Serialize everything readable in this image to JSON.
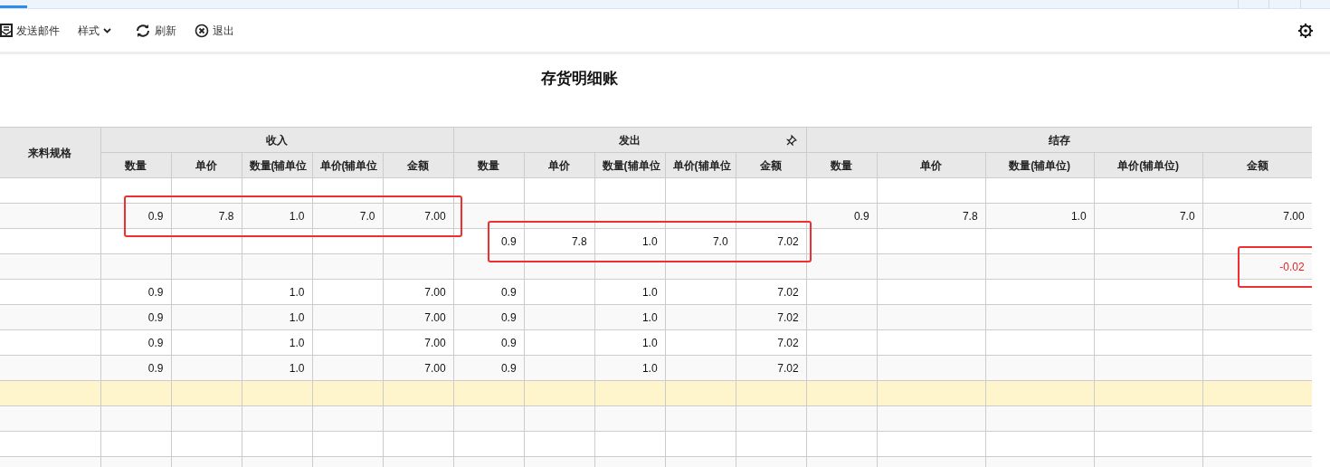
{
  "toolbar": {
    "items": [
      {
        "kind": "mail",
        "label": "发送邮件"
      },
      {
        "kind": "dropdown",
        "label": "样式"
      },
      {
        "kind": "refresh",
        "label": "刷新"
      },
      {
        "kind": "exit",
        "label": "退出"
      }
    ]
  },
  "title": "存货明细账",
  "table": {
    "first_column": "来料规格",
    "groups": [
      {
        "label": "收入",
        "pinned": false,
        "columns": [
          "数量",
          "单价",
          "数量(辅单位",
          "单价(辅单位",
          "金额"
        ]
      },
      {
        "label": "发出",
        "pinned": true,
        "columns": [
          "数量",
          "单价",
          "数量(辅单位",
          "单价(辅单位",
          "金额"
        ]
      },
      {
        "label": "结存",
        "pinned": false,
        "columns": [
          "数量",
          "单价",
          "数量(辅单位)",
          "单价(辅单位)",
          "金额"
        ]
      }
    ],
    "rows": [
      {
        "selected": false,
        "box_income": false,
        "box_issue": false,
        "box_balance_amount": false,
        "cells": [
          "",
          "",
          "",
          "",
          "",
          "",
          "",
          "",
          "",
          "",
          "",
          "",
          "",
          "",
          "",
          ""
        ]
      },
      {
        "selected": false,
        "box_income": true,
        "box_issue": false,
        "box_balance_amount": false,
        "warning": false,
        "cells": [
          "",
          "0.9",
          "7.8",
          "1.0",
          "7.0",
          "7.00",
          "",
          "",
          "",
          "",
          "",
          "0.9",
          "7.8",
          "1.0",
          "7.0",
          "7.00"
        ]
      },
      {
        "selected": false,
        "box_income": false,
        "box_issue": true,
        "box_balance_amount": false,
        "warning": false,
        "cells": [
          "",
          "",
          "",
          "",
          "",
          "",
          "0.9",
          "7.8",
          "1.0",
          "7.0",
          "7.02",
          "",
          "",
          "",
          "",
          ""
        ]
      },
      {
        "selected": false,
        "box_income": false,
        "box_issue": false,
        "box_balance_amount": true,
        "warning": true,
        "cells": [
          "",
          "",
          "",
          "",
          "",
          "",
          "",
          "",
          "",
          "",
          "",
          "",
          "",
          "",
          "",
          "-0.02"
        ]
      },
      {
        "selected": false,
        "box_income": false,
        "box_issue": false,
        "box_balance_amount": false,
        "warning": false,
        "cells": [
          "",
          "0.9",
          "",
          "1.0",
          "",
          "7.00",
          "0.9",
          "",
          "1.0",
          "",
          "7.02",
          "",
          "",
          "",
          "",
          ""
        ]
      },
      {
        "selected": false,
        "box_income": false,
        "box_issue": false,
        "box_balance_amount": false,
        "warning": false,
        "cells": [
          "",
          "0.9",
          "",
          "1.0",
          "",
          "7.00",
          "0.9",
          "",
          "1.0",
          "",
          "7.02",
          "",
          "",
          "",
          "",
          ""
        ]
      },
      {
        "selected": false,
        "box_income": false,
        "box_issue": false,
        "box_balance_amount": false,
        "warning": false,
        "cells": [
          "",
          "0.9",
          "",
          "1.0",
          "",
          "7.00",
          "0.9",
          "",
          "1.0",
          "",
          "7.02",
          "",
          "",
          "",
          "",
          ""
        ]
      },
      {
        "selected": false,
        "box_income": false,
        "box_issue": false,
        "box_balance_amount": false,
        "warning": false,
        "cells": [
          "",
          "0.9",
          "",
          "1.0",
          "",
          "7.00",
          "0.9",
          "",
          "1.0",
          "",
          "7.02",
          "",
          "",
          "",
          "",
          ""
        ]
      },
      {
        "selected": true,
        "box_income": false,
        "box_issue": false,
        "box_balance_amount": false,
        "cells": [
          "",
          "",
          "",
          "",
          "",
          "",
          "",
          "",
          "",
          "",
          "",
          "",
          "",
          "",
          "",
          ""
        ]
      },
      {
        "selected": false,
        "box_income": false,
        "box_issue": false,
        "box_balance_amount": false,
        "cells": [
          "",
          "",
          "",
          "",
          "",
          "",
          "",
          "",
          "",
          "",
          "",
          "",
          "",
          "",
          "",
          ""
        ]
      },
      {
        "selected": false,
        "box_income": false,
        "box_issue": false,
        "box_balance_amount": false,
        "cells": [
          "",
          "",
          "",
          "",
          "",
          "",
          "",
          "",
          "",
          "",
          "",
          "",
          "",
          "",
          "",
          ""
        ]
      },
      {
        "selected": false,
        "box_income": false,
        "box_issue": false,
        "box_balance_amount": false,
        "cells": [
          "",
          "",
          "",
          "",
          "",
          "",
          "",
          "",
          "",
          "",
          "",
          "",
          "",
          "",
          "",
          ""
        ]
      }
    ]
  }
}
